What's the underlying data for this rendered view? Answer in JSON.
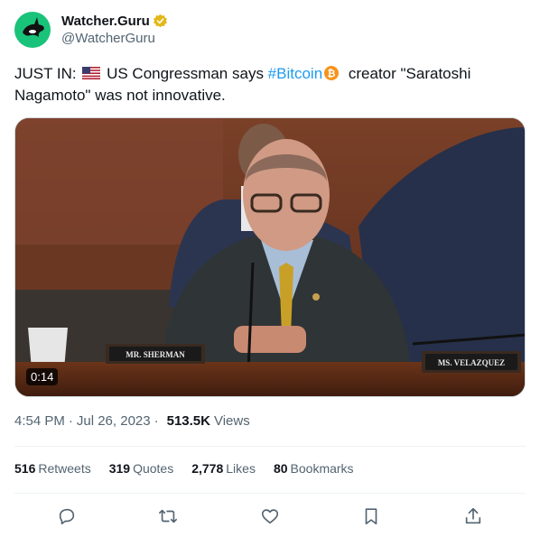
{
  "author": {
    "display_name": "Watcher.Guru",
    "handle": "@WatcherGuru",
    "verified_icon": "gold-verified-badge-icon",
    "avatar_icon": "orca-logo-icon",
    "avatar_color": "#19c37a"
  },
  "tweet": {
    "text_part1": "JUST IN: ",
    "text_part2": " US Congressman says ",
    "hashtag": "#Bitcoin",
    "text_part3": " creator \"Saratoshi Nagamoto\" was not innovative.",
    "hashtag_color": "#1d9bf0"
  },
  "media": {
    "duration": "0:14",
    "nameplate_left": "MR. SHERMAN",
    "nameplate_right": "MS. VELAZQUEZ"
  },
  "meta": {
    "time": "4:54 PM",
    "date": "Jul 26, 2023",
    "views_count": "513.5K",
    "views_label": "Views"
  },
  "stats": {
    "retweets_count": "516",
    "retweets_label": "Retweets",
    "quotes_count": "319",
    "quotes_label": "Quotes",
    "likes_count": "2,778",
    "likes_label": "Likes",
    "bookmarks_count": "80",
    "bookmarks_label": "Bookmarks"
  },
  "actions": [
    "reply-icon",
    "retweet-icon",
    "like-icon",
    "bookmark-icon",
    "share-icon"
  ]
}
